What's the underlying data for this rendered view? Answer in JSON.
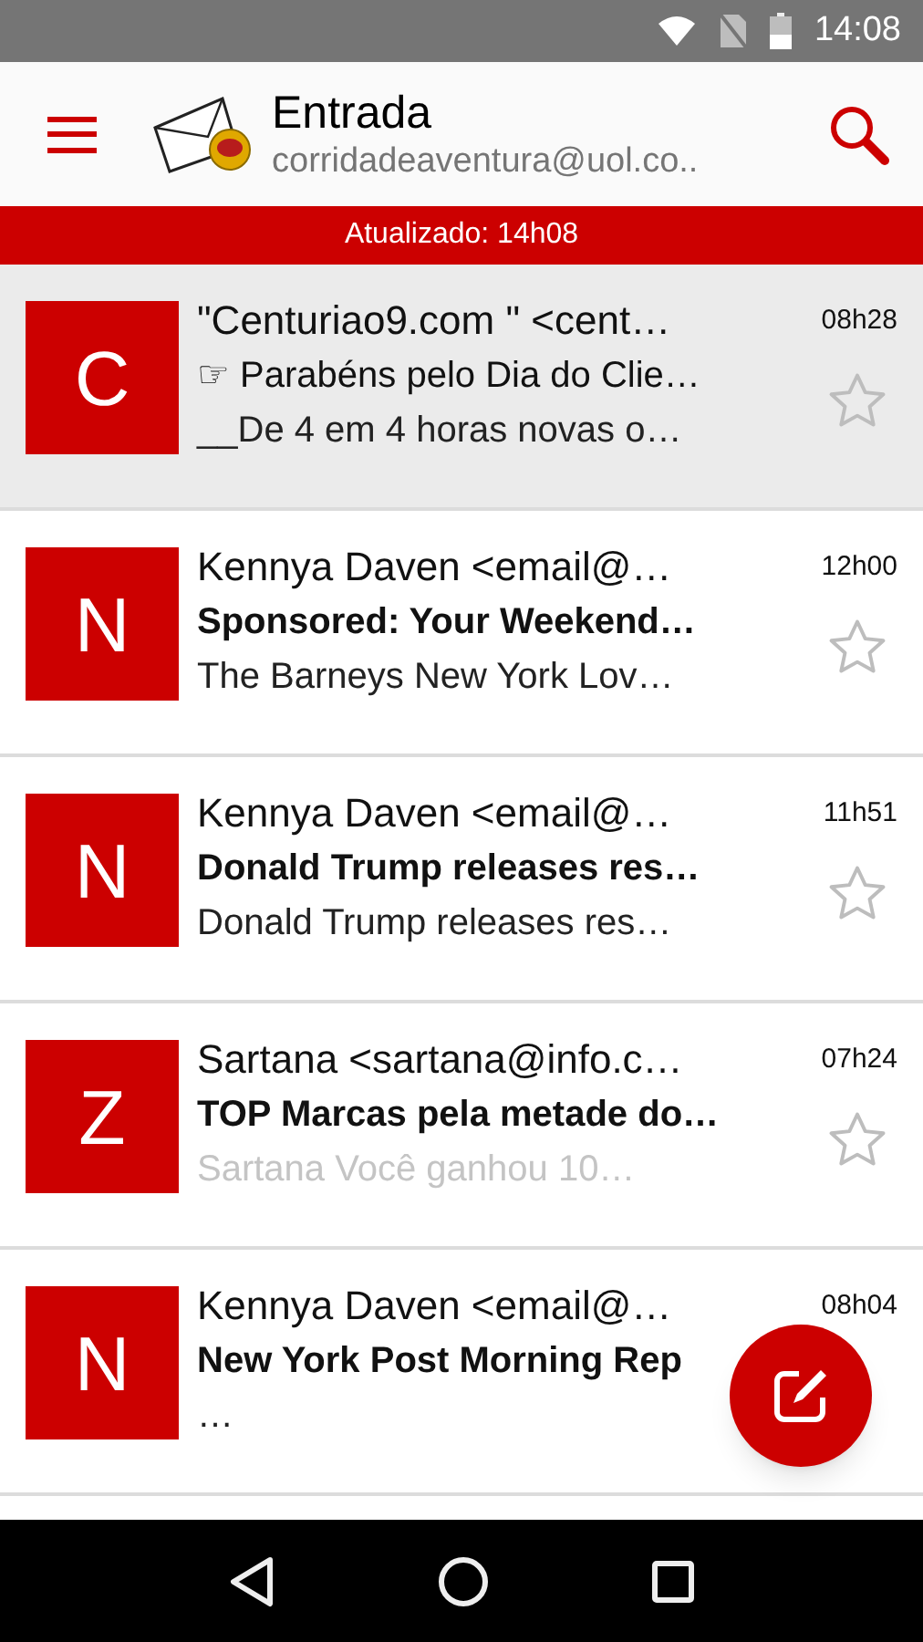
{
  "status_bar": {
    "time": "14:08"
  },
  "app_bar": {
    "title": "Entrada",
    "account": "corridadeaventura@uol.co.."
  },
  "update_banner": "Atualizado: 14h08",
  "messages": [
    {
      "initial": "C",
      "sender": "\"Centuriao9.com \" <cent…",
      "subject": "☞ Parabéns pelo Dia do Clie…",
      "preview": "__De 4 em 4 horas novas o…",
      "time": "08h28",
      "selected": true,
      "unread": false,
      "faded": false,
      "starred": false
    },
    {
      "initial": "N",
      "sender": "Kennya Daven <email@…",
      "subject": "Sponsored: Your Weekend…",
      "preview": "The Barneys New York Lov…",
      "time": "12h00",
      "selected": false,
      "unread": true,
      "faded": false,
      "starred": false
    },
    {
      "initial": "N",
      "sender": "Kennya Daven <email@…",
      "subject": "Donald Trump releases res…",
      "preview": "Donald Trump releases res…",
      "time": "11h51",
      "selected": false,
      "unread": true,
      "faded": false,
      "starred": false
    },
    {
      "initial": "Z",
      "sender": "Sartana <sartana@info.c…",
      "subject": "TOP Marcas pela metade do…",
      "preview": "Sartana Você ganhou 10…",
      "time": "07h24",
      "selected": false,
      "unread": true,
      "faded": true,
      "starred": false
    },
    {
      "initial": "N",
      "sender": "Kennya Daven <email@…",
      "subject": "New York Post Morning Rep",
      "preview": "…",
      "time": "08h04",
      "selected": false,
      "unread": true,
      "faded": false
    }
  ]
}
